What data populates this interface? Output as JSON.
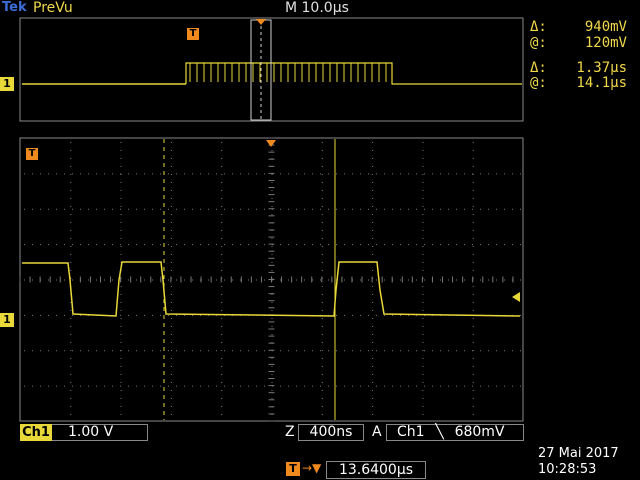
{
  "header": {
    "brand": "Tek",
    "mode": "PreVu",
    "timebase": "M 10.0µs"
  },
  "measurements": [
    {
      "label": "Δ:",
      "value": "940mV"
    },
    {
      "label": "@:",
      "value": "120mV"
    },
    {
      "label": "Δ:",
      "value": "1.37µs"
    },
    {
      "label": "@:",
      "value": "14.1µs"
    }
  ],
  "channel": {
    "name": "Ch1",
    "vdiv": "1.00 V",
    "marker": "1"
  },
  "zoom": {
    "label": "Z",
    "value": "400ns"
  },
  "trigger": {
    "label": "A",
    "source": "Ch1",
    "slope": "╲",
    "level": "680mV",
    "marker": "T"
  },
  "trigger_position": {
    "value": "13.6400µs",
    "icon": "T",
    "arrow": "→▼"
  },
  "datetime": {
    "date": "27 Mai  2017",
    "time": "10:28:53"
  },
  "colors": {
    "trace": "#e8d83a",
    "grid": "#7a7a7a",
    "trigger": "#f08a1e",
    "brand": "#3c6dd8"
  }
}
